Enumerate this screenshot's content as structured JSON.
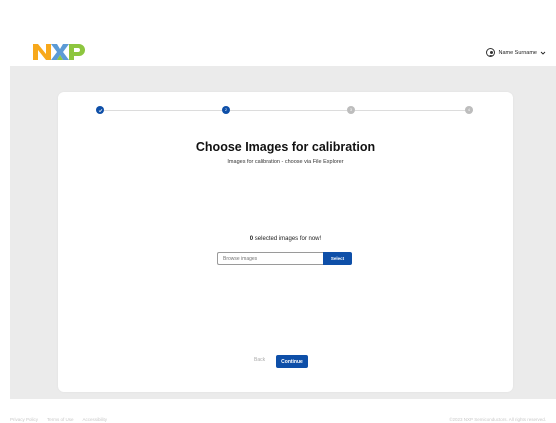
{
  "header": {
    "logo_alt": "NXP",
    "user_name": "Name Surname",
    "colors": {
      "logo_orange": "#f7a81b",
      "logo_blue": "#5c9bd6",
      "logo_green": "#8dc63f"
    }
  },
  "stepper": {
    "steps": [
      {
        "label": "✓",
        "state": "done"
      },
      {
        "label": "2",
        "state": "active"
      },
      {
        "label": "3",
        "state": "todo"
      },
      {
        "label": "4",
        "state": "todo"
      }
    ]
  },
  "content": {
    "title": "Choose Images for calibration",
    "subtitle": "Images for calibration - choose via File Explorer",
    "selected_count": "0",
    "selected_text": " selected images for now!",
    "browse_placeholder": "Browse images",
    "select_label": "Select"
  },
  "actions": {
    "back_label": "Back",
    "continue_label": "Continue"
  },
  "footer": {
    "links": [
      "Privacy Policy",
      "Terms of Use",
      "Accessibility"
    ],
    "copyright": "©2023 NXP Semiconductors. All rights reserved."
  },
  "colors": {
    "primary": "#0e4fa8",
    "background": "#ebebeb",
    "step_todo": "#bdbdbd"
  }
}
